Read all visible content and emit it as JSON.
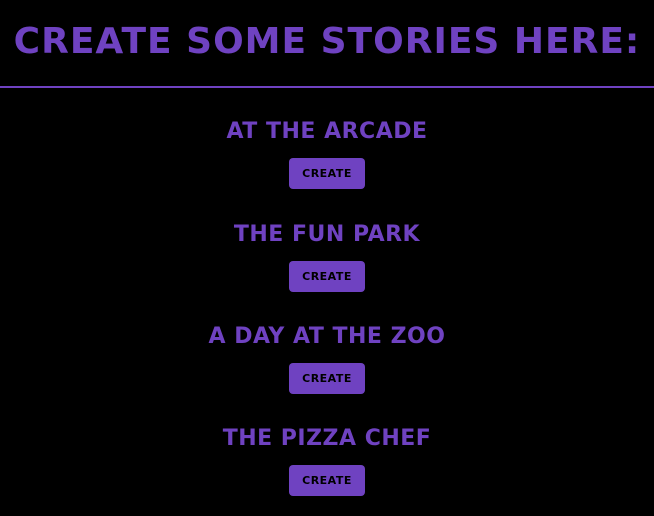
{
  "header": {
    "title": "CREATE SOME STORIES HERE:"
  },
  "stories": [
    {
      "title": "AT THE ARCADE",
      "button_label": "CREATE"
    },
    {
      "title": "THE FUN PARK",
      "button_label": "CREATE"
    },
    {
      "title": "A DAY AT THE ZOO",
      "button_label": "CREATE"
    },
    {
      "title": "THE PIZZA CHEF",
      "button_label": "CREATE"
    }
  ],
  "colors": {
    "background": "#000000",
    "accent": "#6f42c1",
    "button_text": "#000000"
  }
}
